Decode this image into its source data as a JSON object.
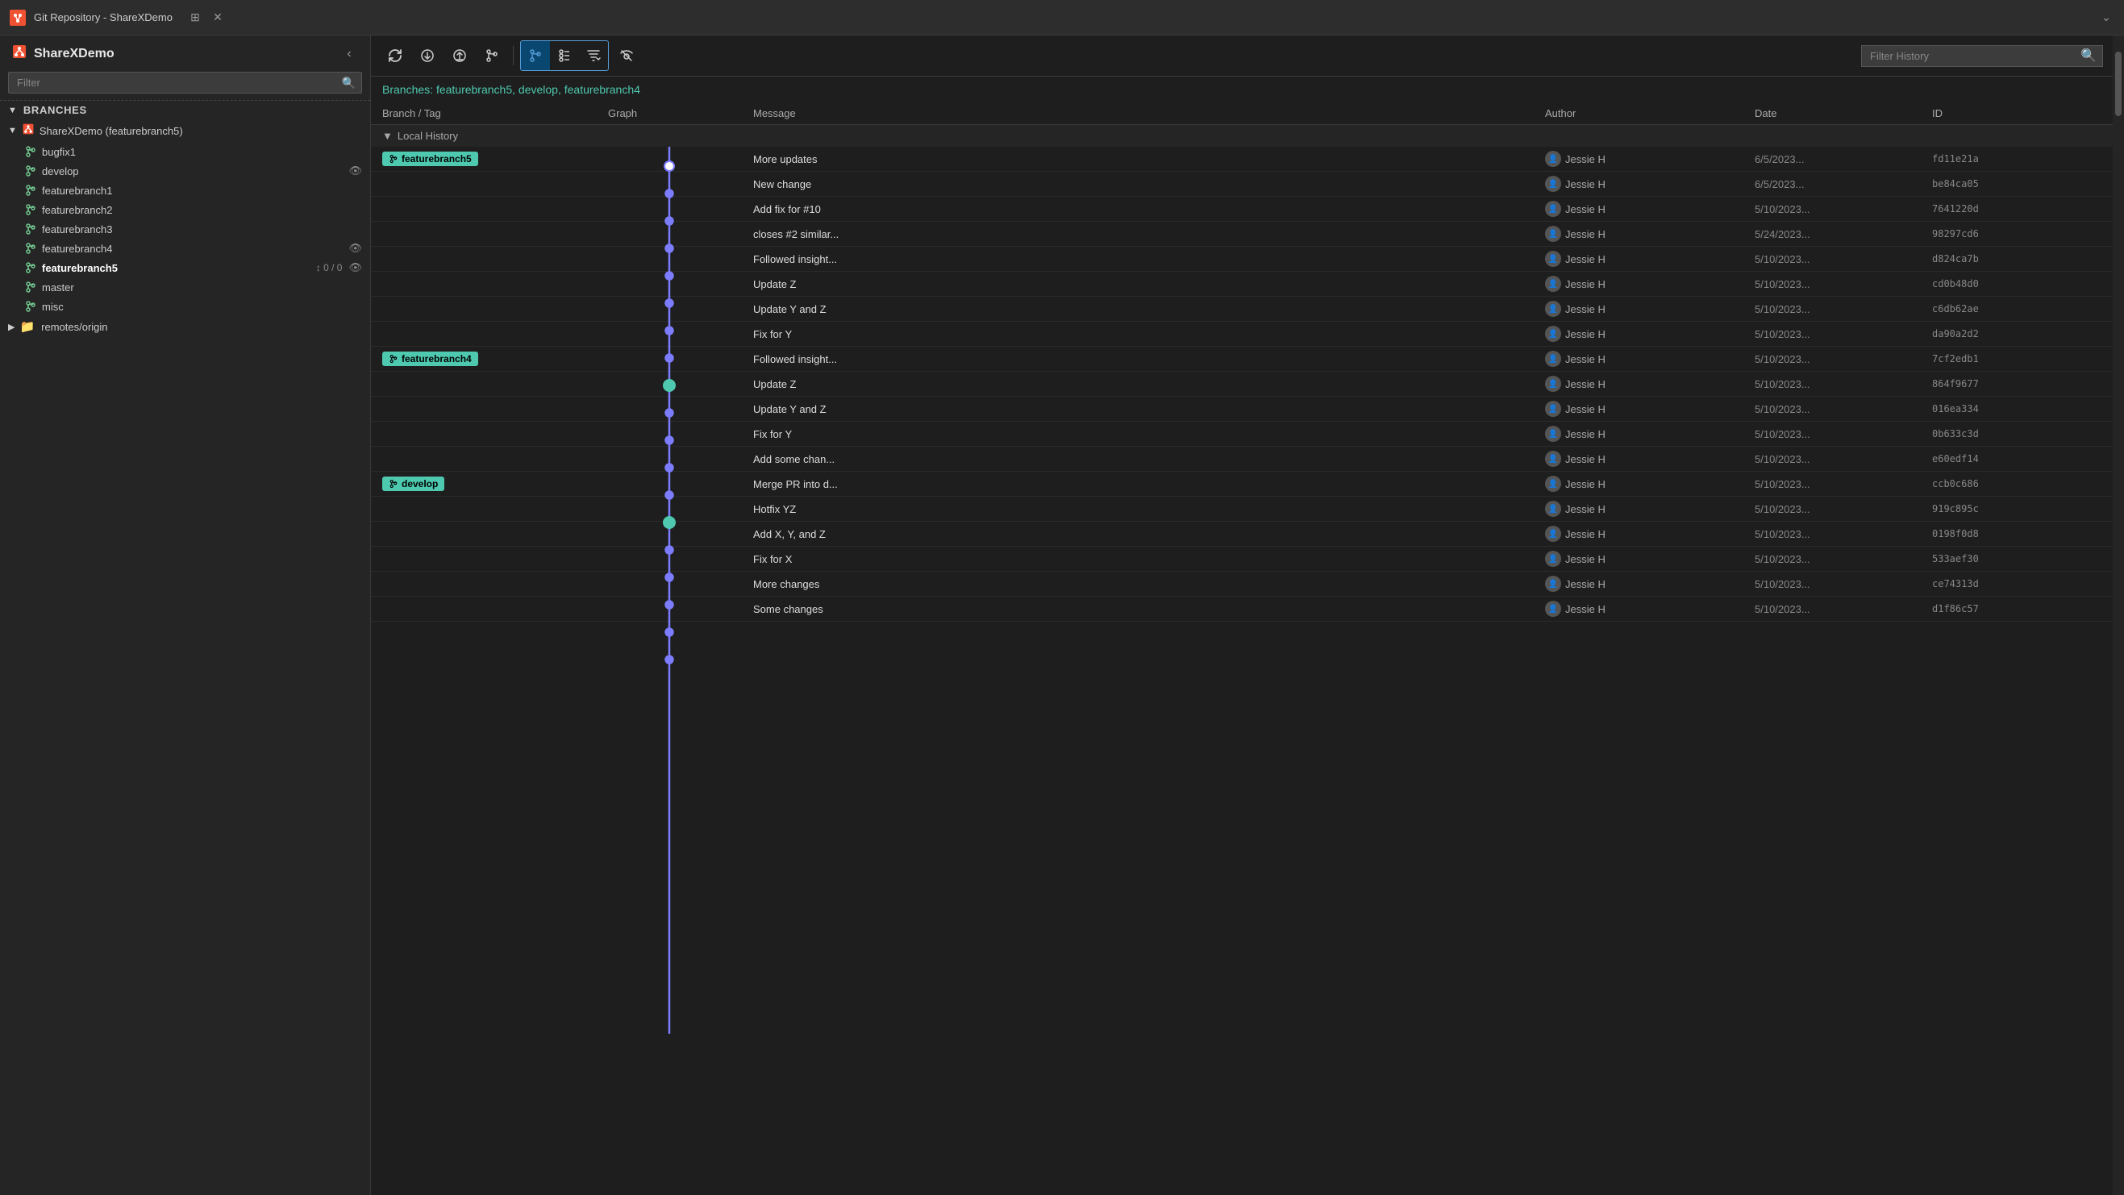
{
  "titleBar": {
    "title": "Git Repository - ShareXDemo",
    "pinLabel": "📌",
    "closeLabel": "✕"
  },
  "sidebar": {
    "title": "ShareXDemo",
    "filterPlaceholder": "Filter",
    "sections": [
      {
        "label": "Branches",
        "expanded": true,
        "items": [
          {
            "name": "ShareXDemo (featurebranch5)",
            "level": 0,
            "icon": "repo",
            "bold": false
          },
          {
            "name": "bugfix1",
            "level": 1,
            "icon": "branch",
            "bold": false
          },
          {
            "name": "develop",
            "level": 1,
            "icon": "branch",
            "bold": false,
            "eye": true
          },
          {
            "name": "featurebranch1",
            "level": 1,
            "icon": "branch",
            "bold": false
          },
          {
            "name": "featurebranch2",
            "level": 1,
            "icon": "branch",
            "bold": false
          },
          {
            "name": "featurebranch3",
            "level": 1,
            "icon": "branch",
            "bold": false
          },
          {
            "name": "featurebranch4",
            "level": 1,
            "icon": "branch",
            "bold": false,
            "eye": true
          },
          {
            "name": "featurebranch5",
            "level": 1,
            "icon": "branch",
            "bold": true,
            "sync": "↕ 0 / 0",
            "eye": true
          },
          {
            "name": "master",
            "level": 1,
            "icon": "branch",
            "bold": false
          },
          {
            "name": "misc",
            "level": 1,
            "icon": "branch",
            "bold": false
          },
          {
            "name": "remotes/origin",
            "level": 0,
            "icon": "folder",
            "bold": false,
            "collapsed": true
          }
        ]
      }
    ]
  },
  "toolbar": {
    "buttons": [
      {
        "id": "refresh",
        "icon": "↺",
        "label": "Refresh",
        "active": false
      },
      {
        "id": "fetch",
        "icon": "⟳",
        "label": "Fetch",
        "active": false
      },
      {
        "id": "pull",
        "icon": "↓",
        "label": "Pull",
        "active": false
      },
      {
        "id": "branch-action",
        "icon": "⑂",
        "label": "Branch Action",
        "active": false
      }
    ],
    "groupButtons": [
      {
        "id": "graph-view",
        "icon": "⑂",
        "label": "Graph View",
        "active": true
      },
      {
        "id": "list-view",
        "icon": "≡",
        "label": "List View",
        "active": false
      },
      {
        "id": "filter-view",
        "icon": "◇",
        "label": "Filter View",
        "active": false
      }
    ],
    "extraBtn": {
      "id": "hide-remote",
      "icon": "~~",
      "label": "Hide Remote Branches",
      "active": false
    },
    "filterPlaceholder": "Filter History"
  },
  "branchesLabel": {
    "text": "Branches:",
    "branches": [
      "featurebranch5",
      "develop",
      "featurebranch4"
    ]
  },
  "table": {
    "headers": [
      "Branch / Tag",
      "Graph",
      "Message",
      "Author",
      "Date",
      "ID"
    ],
    "sectionLabel": "Local History",
    "rows": [
      {
        "branch": "featurebranch5",
        "branchColor": "#4ec9b0",
        "graphDot": "top",
        "message": "More updates",
        "author": "Jessie H",
        "date": "6/5/2023...",
        "id": "fd11e21a",
        "dotColor": "#fff",
        "dotFill": false
      },
      {
        "branch": "",
        "message": "New change",
        "author": "Jessie H",
        "date": "6/5/2023...",
        "id": "be84ca05",
        "dotColor": "#7c7cff"
      },
      {
        "branch": "",
        "message": "Add fix for #10",
        "author": "Jessie H",
        "date": "5/10/2023...",
        "id": "7641220d",
        "dotColor": "#7c7cff"
      },
      {
        "branch": "",
        "message": "closes #2 similar...",
        "author": "Jessie H",
        "date": "5/24/2023...",
        "id": "98297cd6",
        "dotColor": "#7c7cff"
      },
      {
        "branch": "",
        "message": "Followed insight...",
        "author": "Jessie H",
        "date": "5/10/2023...",
        "id": "d824ca7b",
        "dotColor": "#7c7cff"
      },
      {
        "branch": "",
        "message": "Update Z",
        "author": "Jessie H",
        "date": "5/10/2023...",
        "id": "cd0b48d0",
        "dotColor": "#7c7cff"
      },
      {
        "branch": "",
        "message": "Update Y and Z",
        "author": "Jessie H",
        "date": "5/10/2023...",
        "id": "c6db62ae",
        "dotColor": "#7c7cff"
      },
      {
        "branch": "",
        "message": "Fix for Y",
        "author": "Jessie H",
        "date": "5/10/2023...",
        "id": "da90a2d2",
        "dotColor": "#7c7cff"
      },
      {
        "branch": "featurebranch4",
        "branchColor": "#4ec9b0",
        "message": "Followed insight...",
        "author": "Jessie H",
        "date": "5/10/2023...",
        "id": "7cf2edb1",
        "dotColor": "#4ec9b0",
        "dotFill": true
      },
      {
        "branch": "",
        "message": "Update Z",
        "author": "Jessie H",
        "date": "5/10/2023...",
        "id": "864f9677",
        "dotColor": "#7c7cff"
      },
      {
        "branch": "",
        "message": "Update Y and Z",
        "author": "Jessie H",
        "date": "5/10/2023...",
        "id": "016ea334",
        "dotColor": "#7c7cff"
      },
      {
        "branch": "",
        "message": "Fix for Y",
        "author": "Jessie H",
        "date": "5/10/2023...",
        "id": "0b633c3d",
        "dotColor": "#7c7cff"
      },
      {
        "branch": "",
        "message": "Add some chan...",
        "author": "Jessie H",
        "date": "5/10/2023...",
        "id": "e60edf14",
        "dotColor": "#7c7cff"
      },
      {
        "branch": "develop",
        "branchColor": "#4ec9b0",
        "message": "Merge PR into d...",
        "author": "Jessie H",
        "date": "5/10/2023...",
        "id": "ccb0c686",
        "dotColor": "#4ec9b0",
        "dotFill": true
      },
      {
        "branch": "",
        "message": "Hotfix YZ",
        "author": "Jessie H",
        "date": "5/10/2023...",
        "id": "919c895c",
        "dotColor": "#7c7cff"
      },
      {
        "branch": "",
        "message": "Add X, Y, and Z",
        "author": "Jessie H",
        "date": "5/10/2023...",
        "id": "0198f0d8",
        "dotColor": "#7c7cff"
      },
      {
        "branch": "",
        "message": "Fix for X",
        "author": "Jessie H",
        "date": "5/10/2023...",
        "id": "533aef30",
        "dotColor": "#7c7cff"
      },
      {
        "branch": "",
        "message": "More changes",
        "author": "Jessie H",
        "date": "5/10/2023...",
        "id": "ce74313d",
        "dotColor": "#7c7cff"
      },
      {
        "branch": "",
        "message": "Some changes",
        "author": "Jessie H",
        "date": "5/10/2023...",
        "id": "d1f86c57",
        "dotColor": "#7c7cff"
      }
    ]
  }
}
